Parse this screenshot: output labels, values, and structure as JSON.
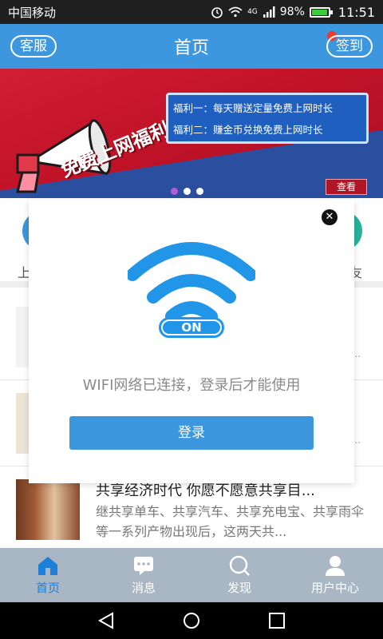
{
  "status_bar": {
    "carrier": "中国移动",
    "network_badge": "4G",
    "battery": "98%",
    "battery_level": 0.98,
    "time": "11:51"
  },
  "header": {
    "left_button": "客服",
    "title": "首页",
    "right_button": "签到",
    "accent_color": "#3d97de",
    "notification_dot_color": "#ea3b2b"
  },
  "banner": {
    "title": "免费上网福利",
    "lines": [
      "福利一：每天赠送定量免费上网时长",
      "福利二：赚金币兑换免费上网时长"
    ],
    "view_button": "查看",
    "page_count": 3,
    "active_page": 1
  },
  "shortcuts": {
    "left_label_partial": "上",
    "right_label_partial": "友"
  },
  "news": [
    {
      "title": "",
      "desc": "",
      "ellipsis": ".."
    },
    {
      "title": "",
      "desc": "",
      "ellipsis": ".."
    },
    {
      "title": "共享经济时代 你愿不愿意共享目...",
      "desc": "继共享单车、共享汽车、共享充电宝、共享雨伞等一系列产物出现后，这两天共..."
    }
  ],
  "modal": {
    "on_label": "ON",
    "message": "WIFI网络已连接，登录后才能使用",
    "login_button": "登录",
    "close_icon": "close-icon"
  },
  "bottom_nav": {
    "items": [
      {
        "label": "首页",
        "icon": "home-icon",
        "active": true
      },
      {
        "label": "消息",
        "icon": "message-icon",
        "active": false
      },
      {
        "label": "发现",
        "icon": "search-icon",
        "active": false
      },
      {
        "label": "用户中心",
        "icon": "user-icon",
        "active": false
      }
    ]
  }
}
